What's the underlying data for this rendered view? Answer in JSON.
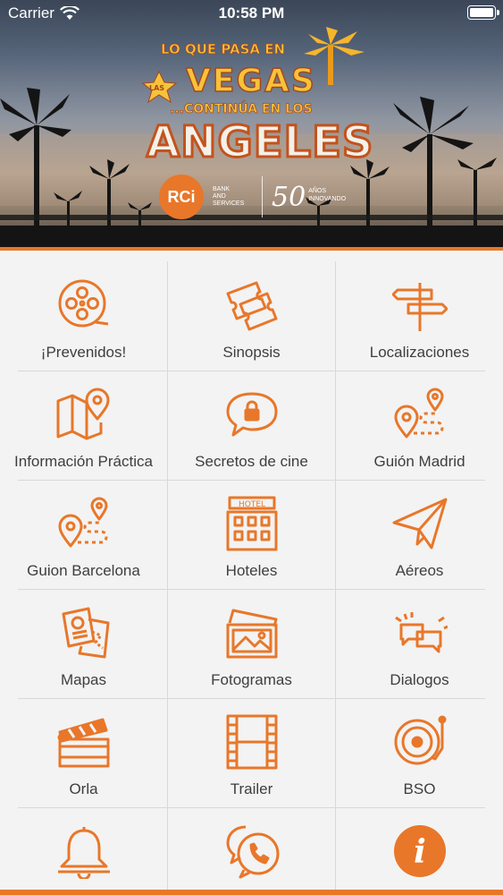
{
  "status_bar": {
    "carrier": "Carrier",
    "time": "10:58 PM"
  },
  "header": {
    "logo_lines": [
      "LO QUE PASA EN",
      "LAS",
      "VEGAS",
      "...CONTINÚA EN LOS",
      "ANGELES"
    ],
    "brand": {
      "rci": "RCi",
      "rci_sub": [
        "BANK",
        "AND",
        "SERVICES"
      ],
      "anniversary_number": "50",
      "anniversary_text": [
        "AÑOS",
        "INNOVANDO"
      ]
    }
  },
  "colors": {
    "accent": "#e8772a",
    "text": "#3e3e3e",
    "divider": "#d8d8d8",
    "background": "#f3f3f3"
  },
  "menu": [
    {
      "label": "¡Prevenidos!",
      "icon": "film-reel-icon"
    },
    {
      "label": "Sinopsis",
      "icon": "tickets-icon"
    },
    {
      "label": "Localizaciones",
      "icon": "signpost-icon"
    },
    {
      "label": "Información Práctica",
      "icon": "map-pin-icon"
    },
    {
      "label": "Secretos de cine",
      "icon": "lock-speech-icon"
    },
    {
      "label": "Guión Madrid",
      "icon": "route-icon"
    },
    {
      "label": "Guion Barcelona",
      "icon": "route-icon"
    },
    {
      "label": "Hoteles",
      "icon": "hotel-icon"
    },
    {
      "label": "Aéreos",
      "icon": "paper-plane-icon"
    },
    {
      "label": "Mapas",
      "icon": "passport-map-icon"
    },
    {
      "label": "Fotogramas",
      "icon": "photos-icon"
    },
    {
      "label": "Dialogos",
      "icon": "chat-bubbles-icon"
    },
    {
      "label": "Orla",
      "icon": "clapperboard-icon"
    },
    {
      "label": "Trailer",
      "icon": "film-strip-icon"
    },
    {
      "label": "BSO",
      "icon": "turntable-icon"
    },
    {
      "label": "",
      "icon": "bell-icon"
    },
    {
      "label": "",
      "icon": "phone-chat-icon"
    },
    {
      "label": "",
      "icon": "info-icon"
    }
  ]
}
